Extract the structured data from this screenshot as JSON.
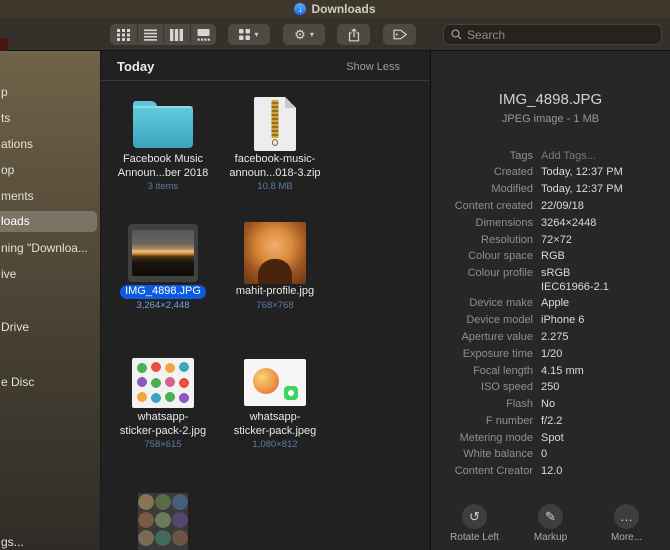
{
  "icons": {
    "downloads_arrow": "↓",
    "chevron_down": "▾",
    "gear": "⚙"
  },
  "titlebar": {
    "title": "Downloads"
  },
  "toolbar": {
    "search_placeholder": "Search"
  },
  "sidebar": {
    "items": [
      {
        "label": "p"
      },
      {
        "label": "ts"
      },
      {
        "label": "ations"
      },
      {
        "label": "op"
      },
      {
        "label": "ments"
      },
      {
        "label": "loads"
      },
      {
        "label": "ning \"Downloa..."
      },
      {
        "label": "ive"
      },
      {
        "label": "Drive"
      },
      {
        "label": "e Disc"
      },
      {
        "label": "gs..."
      }
    ]
  },
  "content": {
    "group_header": "Today",
    "show_less": "Show Less",
    "files": [
      {
        "name_line1": "Facebook Music",
        "name_line2": "Announ...ber 2018",
        "detail": "3 items",
        "type": "folder"
      },
      {
        "name_line1": "facebook-music-",
        "name_line2": "announ...018-3.zip",
        "detail": "10.8 MB",
        "type": "zip-archive"
      },
      {
        "name_line1": "IMG_4898.JPG",
        "detail": "3,264×2,448",
        "type": "jpeg-image",
        "selected": true
      },
      {
        "name_line1": "mahit-profile.jpg",
        "detail": "768×768",
        "type": "jpeg-image"
      },
      {
        "name_line1": "whatsapp-",
        "name_line2": "sticker-pack-2.jpg",
        "detail": "758×615",
        "type": "jpeg-image"
      },
      {
        "name_line1": "whatsapp-",
        "name_line2": "sticker-pack.jpeg",
        "detail": "1,080×812",
        "type": "jpeg-image"
      }
    ]
  },
  "preview": {
    "title": "IMG_4898.JPG",
    "subtitle": "JPEG image - 1 MB",
    "meta": [
      {
        "label": "Tags",
        "value": "Add Tags...",
        "cls": "muted"
      },
      {
        "label": "Created",
        "value": "Today, 12:37 PM"
      },
      {
        "label": "Modified",
        "value": "Today, 12:37 PM"
      },
      {
        "label": "Content created",
        "value": "22/09/18"
      },
      {
        "label": "Dimensions",
        "value": "3264×2448"
      },
      {
        "label": "Resolution",
        "value": "72×72"
      },
      {
        "label": "Colour space",
        "value": "RGB"
      },
      {
        "label": "Colour profile",
        "value": "sRGB\nIEC61966-2.1"
      },
      {
        "label": "Device make",
        "value": "Apple"
      },
      {
        "label": "Device model",
        "value": "iPhone 6"
      },
      {
        "label": "Aperture value",
        "value": "2.275"
      },
      {
        "label": "Exposure time",
        "value": "1/20"
      },
      {
        "label": "Focal length",
        "value": "4.15 mm"
      },
      {
        "label": "ISO speed",
        "value": "250"
      },
      {
        "label": "Flash",
        "value": "No"
      },
      {
        "label": "F number",
        "value": "f/2.2"
      },
      {
        "label": "Metering mode",
        "value": "Spot"
      },
      {
        "label": "White balance",
        "value": "0"
      },
      {
        "label": "Content Creator",
        "value": "12.0"
      }
    ],
    "actions": [
      {
        "label": "Rotate Left",
        "glyph": "↺"
      },
      {
        "label": "Markup",
        "glyph": "✎"
      },
      {
        "label": "More...",
        "glyph": "…"
      }
    ]
  }
}
